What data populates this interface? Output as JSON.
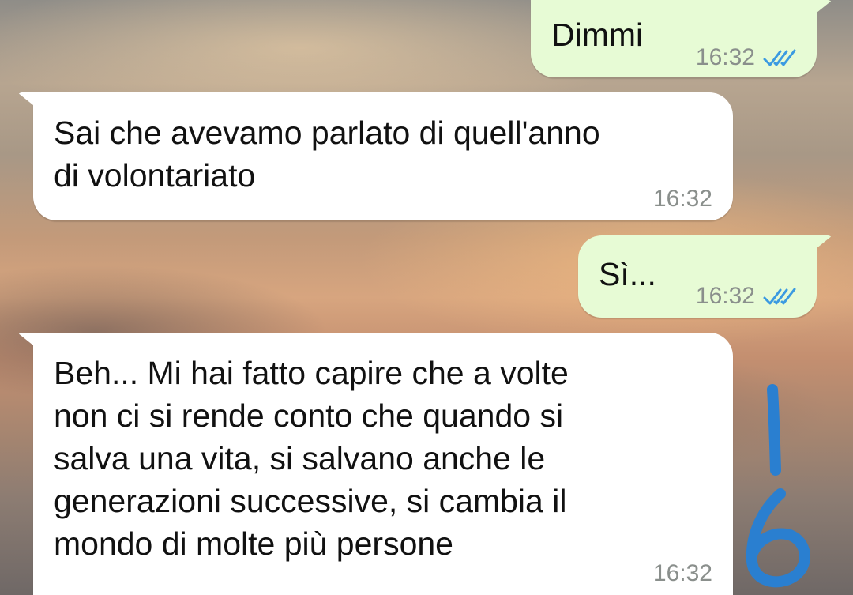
{
  "messages": [
    {
      "direction": "out",
      "text": "Dimmi",
      "time": "16:32",
      "status": "read"
    },
    {
      "direction": "in",
      "text": "Sai che avevamo parlato di quell'anno\ndi volontariato",
      "time": "16:32"
    },
    {
      "direction": "out",
      "text": "Sì...",
      "time": "16:32",
      "status": "read"
    },
    {
      "direction": "in",
      "text": "Beh... Mi hai fatto capire che a volte\nnon ci si rende conto che quando si\nsalva una vita, si salvano anche le\ngenerazioni successive, si cambia il\nmondo di molte più persone",
      "time": "16:32"
    }
  ],
  "annotation": {
    "text": "16",
    "color": "#2a7fd0"
  },
  "colors": {
    "outgoing_bubble": "#e7fbd5",
    "incoming_bubble": "#ffffff",
    "read_ticks": "#3b9ae1",
    "timestamp": "#8a8f8c"
  },
  "icons": {
    "read_receipt": "double-check-icon"
  }
}
